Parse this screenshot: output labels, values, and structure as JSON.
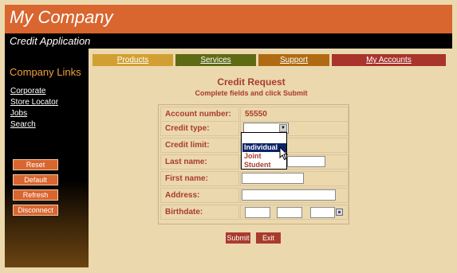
{
  "header": {
    "title": "My Company",
    "subtitle": "Credit Application"
  },
  "sidebar": {
    "title": "Company Links",
    "links": [
      "Corporate",
      "Store Locator",
      "Jobs",
      "Search"
    ],
    "buttons": [
      "Reset",
      "Default",
      "Refresh",
      "Disconnect"
    ]
  },
  "nav": {
    "items": [
      {
        "label": "Products",
        "color": "#d2a032"
      },
      {
        "label": "Services",
        "color": "#5e6b14"
      },
      {
        "label": "Support",
        "color": "#b06b12"
      },
      {
        "label": "My Accounts",
        "color": "#a8342c"
      }
    ]
  },
  "form": {
    "title": "Credit Request",
    "subtitle": "Complete fields and click Submit",
    "labels": {
      "account_number": "Account number:",
      "credit_type": "Credit type:",
      "credit_limit": "Credit limit:",
      "last_name": "Last name:",
      "first_name": "First name:",
      "address": "Address:",
      "birthdate": "Birthdate:"
    },
    "account_number_value": "55550",
    "credit_type_options": [
      "Individual",
      "Joint",
      "Student"
    ],
    "credit_type_highlighted": "Individual",
    "submit_label": "Submit",
    "exit_label": "Exit"
  },
  "colors": {
    "accent": "#d9652f",
    "label_text": "#a83c2c",
    "background": "#ecd8ad"
  }
}
